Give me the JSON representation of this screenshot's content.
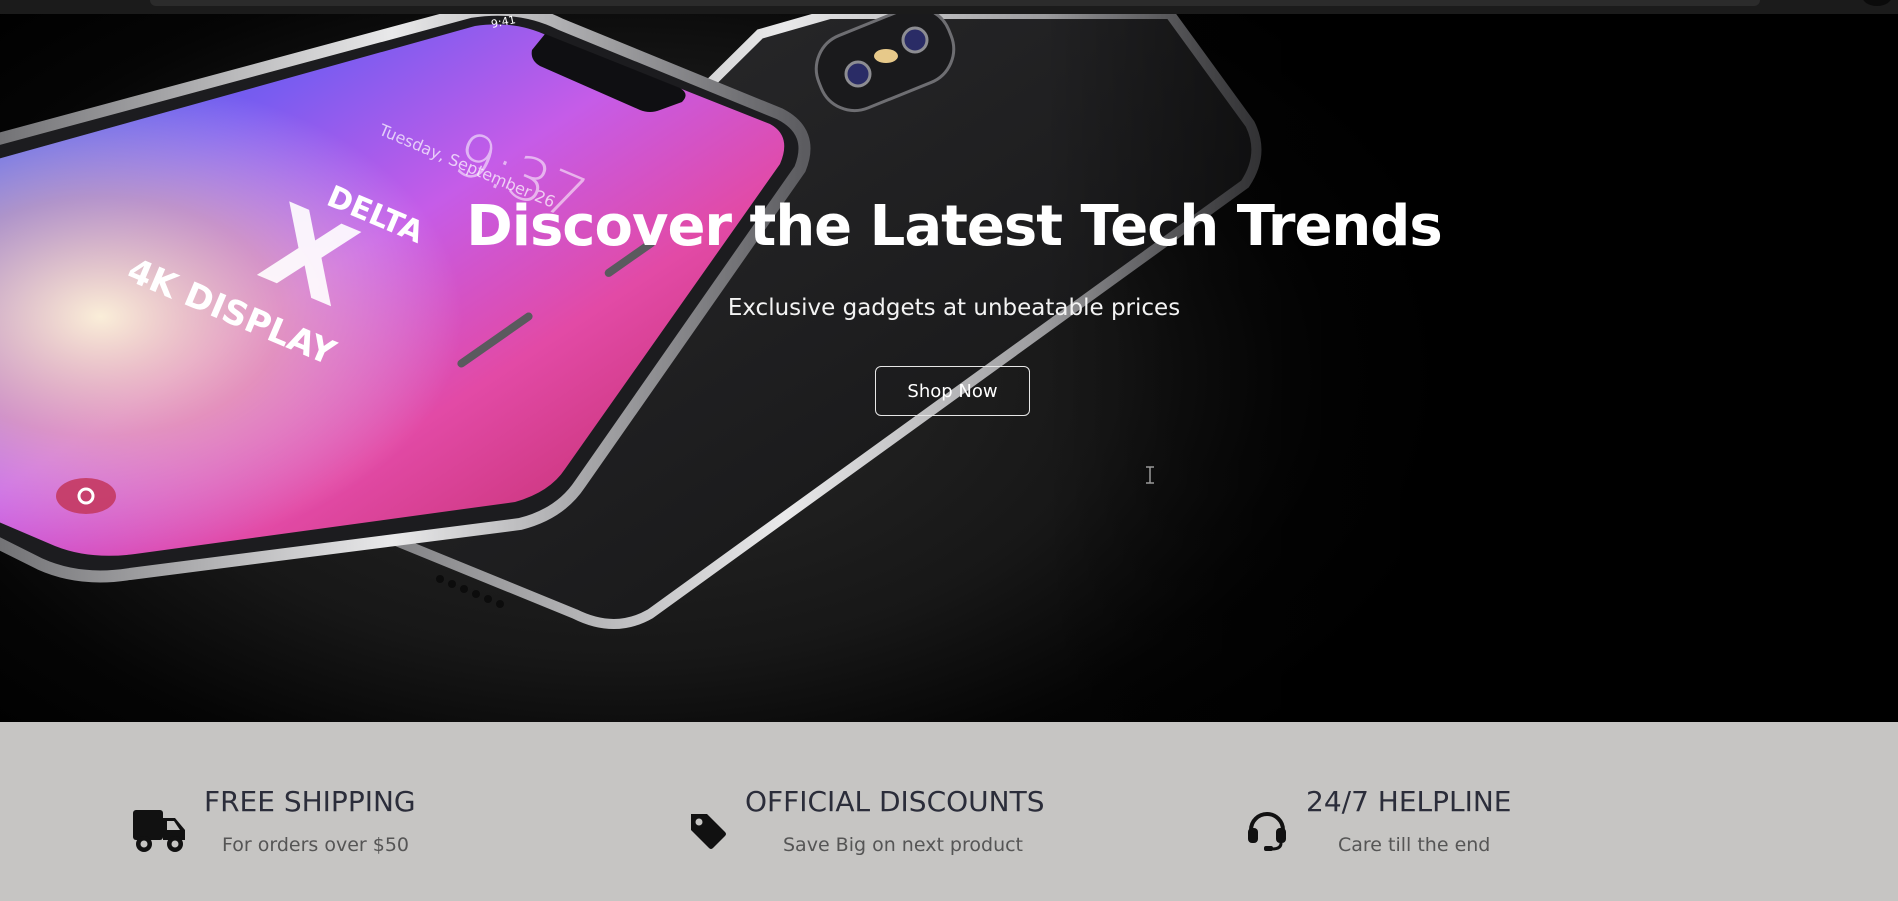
{
  "hero": {
    "title": "Discover the Latest Tech Trends",
    "subtitle": "Exclusive gadgets at unbeatable prices",
    "button_label": "Shop Now",
    "phone_screen": {
      "time_label": "9:41",
      "clock": "9:37",
      "date": "Tuesday, September 26",
      "brand_line1": "DELTA",
      "brand_line2": "X",
      "brand_line3": "4K DISPLAY"
    }
  },
  "features": [
    {
      "icon": "truck-icon",
      "title": "FREE SHIPPING",
      "subtitle": "For orders over $50"
    },
    {
      "icon": "tag-icon",
      "title": "OFFICIAL DISCOUNTS",
      "subtitle": "Save Big on next product"
    },
    {
      "icon": "headset-icon",
      "title": "24/7 HELPLINE",
      "subtitle": "Care till the end"
    }
  ],
  "colors": {
    "hero_background": "#000000",
    "features_background": "#c6c5c3",
    "feature_title": "#2b2d3a",
    "feature_subtitle": "#555555"
  }
}
